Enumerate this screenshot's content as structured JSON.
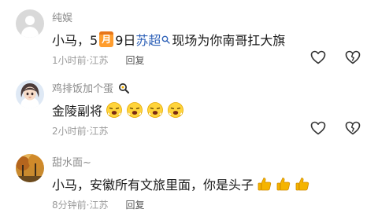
{
  "comments": [
    {
      "username": "纯娱",
      "content": {
        "prefix": "小马，5",
        "calendar_month": "月",
        "middle": "9日",
        "link_text": "苏超",
        "suffix": "现场为你南哥扛大旗"
      },
      "meta": {
        "time": "1小时前",
        "location": "江苏",
        "reply_label": "回复"
      }
    },
    {
      "username": "鸡排饭加个蛋",
      "content": {
        "text": "金陵副将"
      },
      "stickers": [
        "laughing-face-sticker",
        "laughing-face-sticker",
        "laughing-face-sticker",
        "laughing-face-sticker"
      ],
      "meta": {
        "time": "2小时前",
        "location": "江苏",
        "reply_label": ""
      }
    },
    {
      "username": "甜水面~",
      "content": {
        "text": "小马，安徽所有文旅里面，你是头子"
      },
      "emojis": [
        "thumbs-up",
        "thumbs-up",
        "thumbs-up"
      ],
      "meta": {
        "time": "8分钟前",
        "location": "江苏",
        "reply_label": "回复"
      }
    }
  ],
  "separator": " · ",
  "colors": {
    "link": "#2f62b8",
    "muted": "#9a9a9a",
    "username": "#8a8a8a",
    "calendar": "#ff9d2e",
    "thumb": "#f5b400"
  }
}
